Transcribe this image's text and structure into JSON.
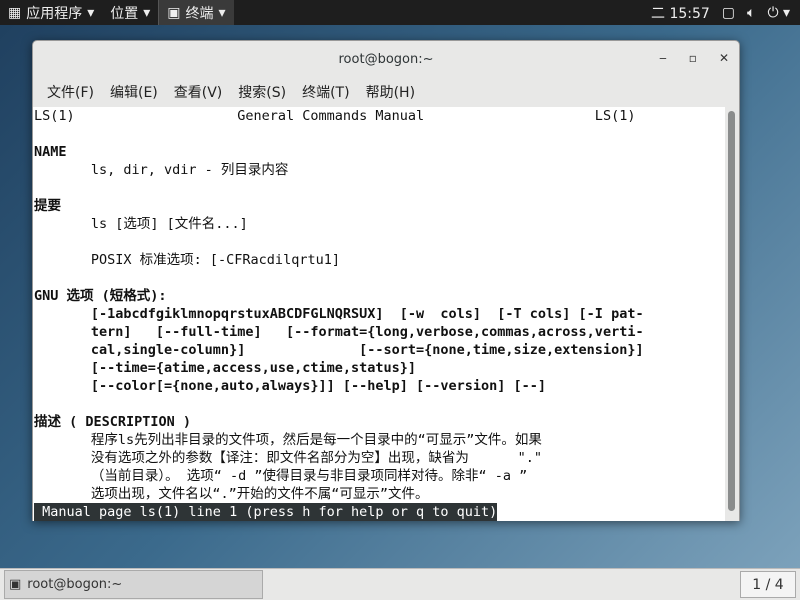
{
  "topbar": {
    "apps": "应用程序",
    "places": "位置",
    "terminal": "终端",
    "day": "二",
    "time": "15:57"
  },
  "window": {
    "title": "root@bogon:~",
    "menu": [
      "文件(F)",
      "编辑(E)",
      "查看(V)",
      "搜索(S)",
      "终端(T)",
      "帮助(H)"
    ]
  },
  "terminal": {
    "lines": [
      {
        "t": "LS(1)                    General Commands Manual                     LS(1)",
        "b": false
      },
      {
        "t": "",
        "b": false
      },
      {
        "t": "NAME",
        "b": true
      },
      {
        "t": "       ls, dir, vdir - 列目录内容",
        "b": false
      },
      {
        "t": "",
        "b": false
      },
      {
        "t": "提要",
        "b": true
      },
      {
        "t": "       ls [选项] [文件名...]",
        "b": false
      },
      {
        "t": "",
        "b": false
      },
      {
        "t": "       POSIX 标准选项: [-CFRacdilqrtu1]",
        "b": false
      },
      {
        "t": "",
        "b": false
      },
      {
        "t": "GNU 选项 (短格式):",
        "b": true
      },
      {
        "t": "       [-1abcdfgiklmnopqrstuxABCDFGLNQRSUX]  [-w  cols]  [-T cols] [-I pat-",
        "b": true
      },
      {
        "t": "       tern]   [--full-time]   [--format={long,verbose,commas,across,verti-",
        "b": true
      },
      {
        "t": "       cal,single-column}]              [--sort={none,time,size,extension}]",
        "b": true
      },
      {
        "t": "       [--time={atime,access,use,ctime,status}]",
        "b": true
      },
      {
        "t": "       [--color[={none,auto,always}]] [--help] [--version] [--]",
        "b": true
      },
      {
        "t": "",
        "b": false
      },
      {
        "t": "描述 ( DESCRIPTION )",
        "b": true
      },
      {
        "t": "       程序ls先列出非目录的文件项，然后是每一个目录中的“可显示”文件。如果",
        "b": false
      },
      {
        "t": "       没有选项之外的参数【译注：即文件名部分为空】出现，缺省为      \".\"",
        "b": false
      },
      {
        "t": "       （当前目录）。 选项“ -d ”使得目录与非目录项同样对待。除非“ -a ”",
        "b": false
      },
      {
        "t": "       选项出现，文件名以“.”开始的文件不属“可显示”文件。",
        "b": false
      }
    ],
    "status": " Manual page ls(1) line 1 (press h for help or q to quit)"
  },
  "taskbar": {
    "task": "root@bogon:~",
    "pager": "1 / 4"
  }
}
